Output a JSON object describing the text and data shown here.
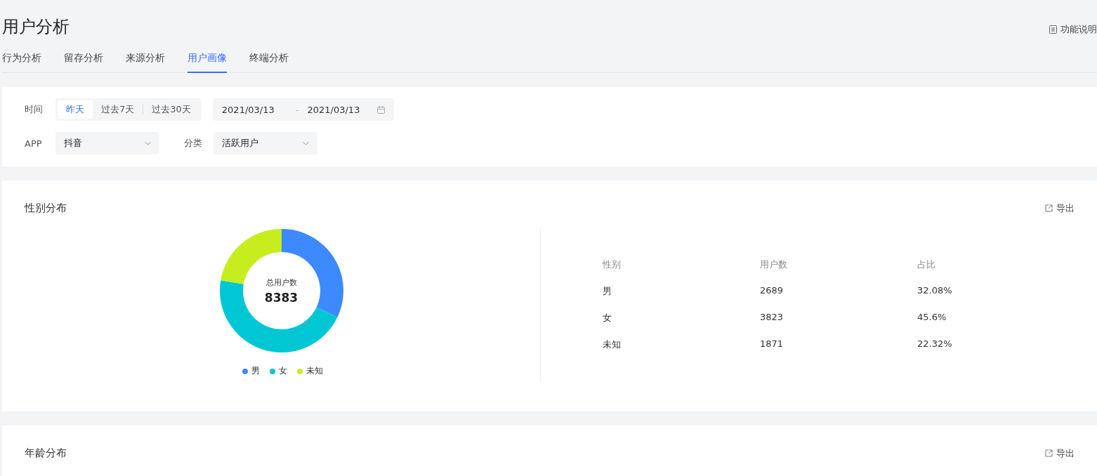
{
  "page": {
    "title": "用户分析",
    "help_link": "功能说明"
  },
  "tabs": [
    {
      "label": "行为分析",
      "selected": false
    },
    {
      "label": "留存分析",
      "selected": false
    },
    {
      "label": "来源分析",
      "selected": false
    },
    {
      "label": "用户画像",
      "selected": true
    },
    {
      "label": "终端分析",
      "selected": false
    }
  ],
  "filters": {
    "time_label": "时间",
    "ranges": [
      {
        "label": "昨天",
        "selected": true
      },
      {
        "label": "过去7天",
        "selected": false
      },
      {
        "label": "过去30天",
        "selected": false
      }
    ],
    "date_start": "2021/03/13",
    "date_separator": "-",
    "date_end": "2021/03/13",
    "app_label": "APP",
    "app_value": "抖音",
    "category_label": "分类",
    "category_value": "活跃用户"
  },
  "gender_card": {
    "title": "性别分布",
    "export": "导出",
    "center_label": "总用户数",
    "center_value": "8383",
    "chart_data": {
      "type": "donut",
      "categories": [
        "男",
        "女",
        "未知"
      ],
      "values": [
        32.08,
        45.6,
        22.32
      ]
    },
    "slice_colors": [
      {
        "color": "#3d89ff"
      },
      {
        "color": "#00c7d3"
      },
      {
        "color": "#c6ee1f"
      }
    ],
    "table": {
      "columns": [
        "性别",
        "用户数",
        "占比"
      ],
      "rows": [
        [
          "男",
          "2689",
          "32.08%"
        ],
        [
          "女",
          "3823",
          "45.6%"
        ],
        [
          "未知",
          "1871",
          "22.32%"
        ]
      ]
    }
  },
  "age_card": {
    "title": "年龄分布",
    "export": "导出"
  }
}
